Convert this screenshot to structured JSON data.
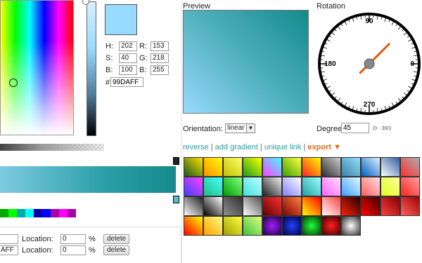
{
  "color": {
    "hsb": [
      {
        "label": "H:",
        "value": "202"
      },
      {
        "label": "S:",
        "value": "40"
      },
      {
        "label": "B:",
        "value": "100"
      }
    ],
    "rgb": [
      {
        "label": "R:",
        "value": "153"
      },
      {
        "label": "G:",
        "value": "218"
      },
      {
        "label": "B:",
        "value": "255"
      }
    ],
    "hash": "#",
    "hex": "99DAFF",
    "swatch": "#99DAFF"
  },
  "stops": [
    {
      "value": "",
      "location_label": "Location:",
      "location": "0",
      "unit": "%",
      "delete_label": "delete"
    },
    {
      "value": "AFF",
      "location_label": "Location:",
      "location": "0",
      "unit": "%",
      "delete_label": "delete"
    }
  ],
  "palette_colors": [
    "#00aa00",
    "#00ff00",
    "#00aaaa",
    "#00ffff",
    "#0000aa",
    "#0000ff",
    "#aa00aa",
    "#ff00ff",
    "#aa00aa"
  ],
  "preview": {
    "title": "Preview"
  },
  "rotation": {
    "title": "Rotation",
    "ticks": [
      "90",
      "0",
      "270",
      "180"
    ],
    "angle_deg": 45
  },
  "orientation": {
    "label": "Orientation:",
    "value": "linear"
  },
  "degree": {
    "label": "Degree",
    "value": "45",
    "range": "(0 - 360)"
  },
  "links": {
    "reverse": "reverse",
    "add_gradient": "add gradient",
    "unique_link": "unique link",
    "export": "export",
    "sep": "|",
    "export_arrow": "▼"
  },
  "icons": {
    "dropdown": "chevron-down-icon"
  },
  "presets": [
    "linear-gradient(45deg,#1a5a1a,#ffe000)",
    "linear-gradient(45deg,#ff9000,#ffff00)",
    "linear-gradient(45deg,#c0c000,#ffff66)",
    "linear-gradient(45deg,#1aa01a,#ffff00)",
    "linear-gradient(45deg,#ff40ff,#40ffff)",
    "linear-gradient(45deg,#3aa000,#ffff40)",
    "linear-gradient(45deg,#ff2020,#ffff00)",
    "linear-gradient(45deg,#303030,#cccccc)",
    "linear-gradient(45deg,#4080a0,#90e0ff)",
    "linear-gradient(45deg,#0060c0,#e0f0ff)",
    "linear-gradient(45deg,#ffffff,#3060a0)",
    "linear-gradient(45deg,#ff3030,#aaaaaa)",
    "linear-gradient(45deg,#4040ff,#ff40ff)",
    "linear-gradient(45deg,#20c080,#40ffff)",
    "linear-gradient(45deg,#00a000,#80ff80)",
    "linear-gradient(45deg,#40e0e0,#c0ffff)",
    "linear-gradient(45deg,#202020,#f0f0f0)",
    "linear-gradient(45deg,#8080ff,#ffffff)",
    "linear-gradient(45deg,#20a0a0,#a0ffff)",
    "linear-gradient(45deg,#ff60ff,#ffe0ff)",
    "linear-gradient(45deg,#40a0ff,#e0f8ff)",
    "linear-gradient(45deg,#ff6060,#ffe0e0)",
    "linear-gradient(45deg,#e0ff20,#ffffa0)",
    "linear-gradient(45deg,#ff2020,#ffa0a0)",
    "linear-gradient(45deg,#ffffff,#202020)",
    "linear-gradient(45deg,#000000,#ffffff)",
    "linear-gradient(45deg,#909090,#303030)",
    "linear-gradient(45deg,#ffffff,#505050)",
    "linear-gradient(45deg,#600000,#ff3030)",
    "linear-gradient(45deg,#800000,#ff8040)",
    "linear-gradient(45deg,#ffff00,#ff0000)",
    "linear-gradient(45deg,#ffffff,#ff4040)",
    "linear-gradient(45deg,#ff2000,#200000)",
    "linear-gradient(45deg,#ff0000,#400000)",
    "linear-gradient(45deg,#ff4040,#800000)",
    "linear-gradient(45deg,#ff6060,#a00000)",
    "linear-gradient(45deg,#ff0000,#ffff00)",
    "linear-gradient(45deg,#ffa000,#ffff80)",
    "linear-gradient(45deg,#a0a000,#ffff40)",
    "linear-gradient(45deg,#40c040,#e0ff80)",
    "radial-gradient(#a020ff,#200040)",
    "radial-gradient(#2040ff,#000040)",
    "radial-gradient(#20ff40,#004000)",
    "radial-gradient(#ff2020,#400000)",
    "radial-gradient(#ffffff,#303030)"
  ]
}
